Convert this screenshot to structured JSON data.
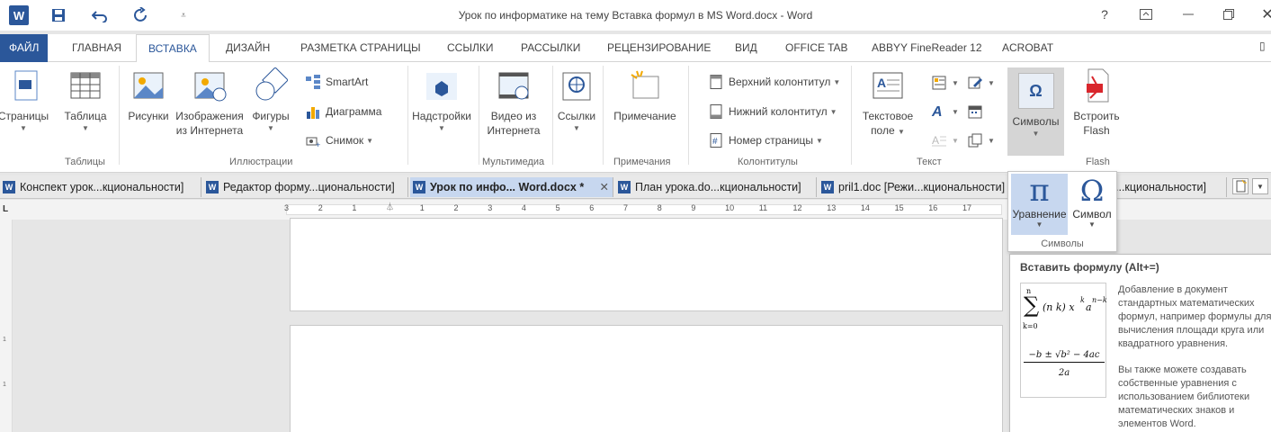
{
  "window": {
    "title": "Урок по информатике на тему Вставка формул в MS Word.docx - Word",
    "help": "?",
    "word_logo": "W"
  },
  "ribbon_tabs": [
    {
      "label": "ФАЙЛ"
    },
    {
      "label": "ГЛАВНАЯ"
    },
    {
      "label": "ВСТАВКА"
    },
    {
      "label": "ДИЗАЙН"
    },
    {
      "label": "РАЗМЕТКА СТРАНИЦЫ"
    },
    {
      "label": "ССЫЛКИ"
    },
    {
      "label": "РАССЫЛКИ"
    },
    {
      "label": "РЕЦЕНЗИРОВАНИЕ"
    },
    {
      "label": "ВИД"
    },
    {
      "label": "OFFICE TAB"
    },
    {
      "label": "ABBYY FineReader 12"
    },
    {
      "label": "ACROBAT"
    }
  ],
  "ribbon": {
    "pages": "Страницы",
    "table": "Таблица",
    "pictures": "Рисунки",
    "online_pictures_1": "Изображения",
    "online_pictures_2": "из Интернета",
    "shapes": "Фигуры",
    "smartart": "SmartArt",
    "chart": "Диаграмма",
    "screenshot": "Снимок",
    "addins": "Надстройки",
    "video_1": "Видео из",
    "video_2": "Интернета",
    "links": "Ссылки",
    "comment": "Примечание",
    "header": "Верхний колонтитул",
    "footer": "Нижний колонтитул",
    "page_number": "Номер страницы",
    "textbox_1": "Текстовое",
    "textbox_2": "поле",
    "symbols": "Символы",
    "flash_1": "Встроить",
    "flash_2": "Flash",
    "groups": {
      "tables": "Таблицы",
      "illustrations": "Иллюстрации",
      "multimedia": "Мультимедиа",
      "comments": "Примечания",
      "headers": "Колонтитулы",
      "text": "Текст",
      "flash": "Flash"
    }
  },
  "doc_tabs": [
    {
      "label": "Конспект урок...кциональности]"
    },
    {
      "label": "Редактор форму...циональности]"
    },
    {
      "label": "Урок по инфо... Word.docx *"
    },
    {
      "label": "План урока.do...кциональности]"
    },
    {
      "label": "pril1.doc [Режи...кциональности]"
    },
    {
      "label": "...кциональности]"
    }
  ],
  "ruler": {
    "numbers": [
      "3",
      "2",
      "1",
      "1",
      "2",
      "3",
      "4",
      "5",
      "6",
      "7",
      "8",
      "9",
      "10",
      "11",
      "12",
      "13",
      "14",
      "15",
      "16",
      "17"
    ],
    "corner": "L"
  },
  "symbols_dropdown": {
    "equation_glyph": "π",
    "equation": "Уравнение",
    "symbol_glyph": "Ω",
    "symbol": "Символ",
    "group": "Символы"
  },
  "tooltip": {
    "title": "Вставить формулу (Alt+=)",
    "desc1": "Добавление в документ стандартных математических формул, например формулы для вычисления площади круга или квадратного уравнения.",
    "desc2": "Вы также можете создавать собственные уравнения с использованием библиотеки математических знаков и элементов Word.",
    "formula1_sum": "∑",
    "formula1_top": "n",
    "formula1_bottom": "k=0",
    "formula1_body": "(n k) x",
    "formula1_sup": "k",
    "formula1_a": "a",
    "formula1_sup2": "n−k",
    "formula2_num": "−b ± √b² − 4ac",
    "formula2_den": "2a"
  },
  "colors": {
    "accent": "#2b579a",
    "tab_active_bg": "#c7d7ef"
  }
}
